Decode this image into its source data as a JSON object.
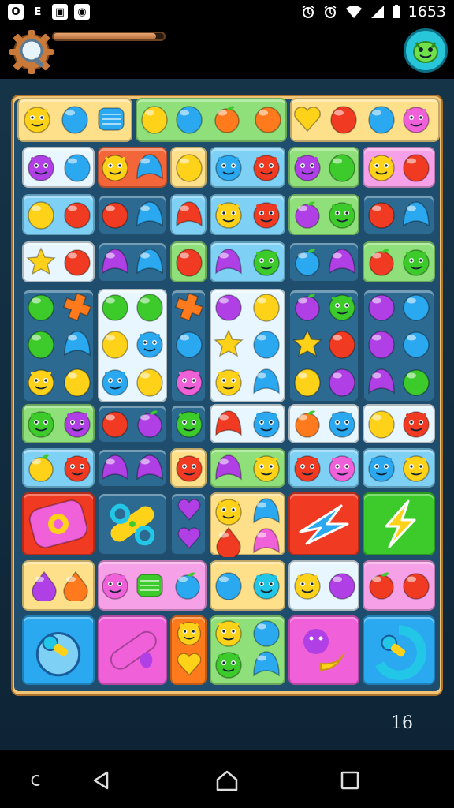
{
  "status_bar": {
    "left_icons": [
      {
        "name": "notification-o-icon",
        "glyph": "O"
      },
      {
        "name": "notification-e-icon",
        "glyph": "E"
      },
      {
        "name": "photo-icon",
        "glyph": "▣"
      },
      {
        "name": "app-notification-icon",
        "glyph": "◉"
      }
    ],
    "right_icons": [
      "alarm-icon",
      "alarm-icon",
      "wifi-icon",
      "signal-icon",
      "battery-icon"
    ],
    "time": "1653"
  },
  "header": {
    "progress_fraction": 0.93,
    "settings_icon": "gear-magnifier-icon",
    "avatar_icon": "green-blob-avatar-icon"
  },
  "board": {
    "score_text": "16",
    "palette": {
      "yellow": "#ffd21a",
      "blue": "#2aa8f0",
      "red": "#f03a22",
      "orange": "#ff7a1c",
      "green": "#3ccb2a",
      "purple": "#b040e6",
      "pink": "#f060d8",
      "cyan": "#22c6e6",
      "tile_yellow": "#ffe08a",
      "tile_blue": "#7fd0f5",
      "tile_green": "#8fe07a",
      "tile_pink": "#f6a0e8",
      "tile_light": "#e8f7ff",
      "tile_red": "#f2663a",
      "tile_dark": "#2d6a91"
    }
  },
  "nav_bar": {
    "recents_icon": "c-icon",
    "back_icon": "back-triangle-icon",
    "home_icon": "home-icon",
    "overview_icon": "square-icon"
  }
}
